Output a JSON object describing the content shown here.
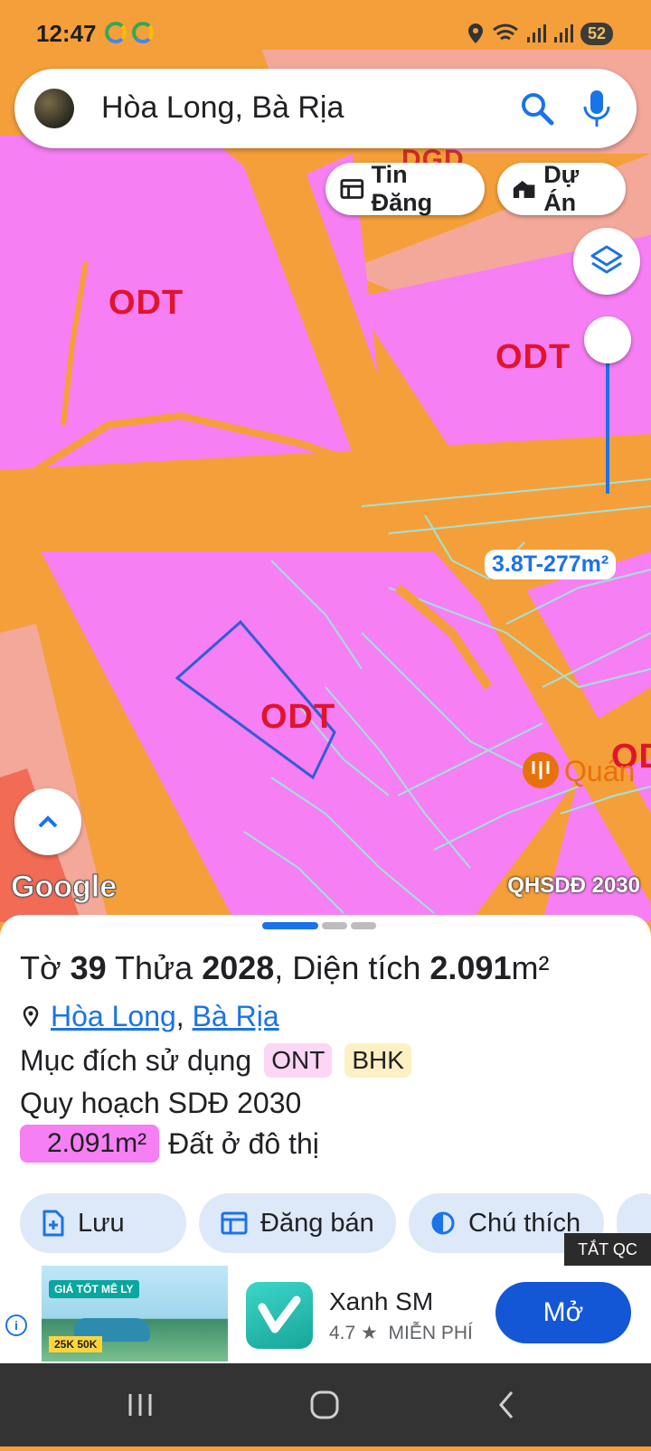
{
  "status_bar": {
    "time": "12:47",
    "battery": "52"
  },
  "search": {
    "query": "Hòa Long, Bà Rịa"
  },
  "chips": {
    "listings": "Tin Đăng",
    "projects": "Dự Án"
  },
  "map": {
    "labels": [
      "ODT",
      "ODT",
      "ODT",
      "OD"
    ],
    "partial_label": "DGD",
    "price_label": "3.8T-277m²",
    "poi_label": "Quán",
    "attribution": "Google",
    "layer_name": "QHSDĐ 2030",
    "colors": {
      "residential": "#F67FF3",
      "road": "#F59F3A",
      "other": "#F4A89A",
      "parcel_outline": "#2F5DD6"
    }
  },
  "parcel": {
    "sheet_word": "Tờ",
    "sheet": "39",
    "plot_word": "Thửa",
    "plot": "2028",
    "area_word": "Diện tích",
    "area": "2.091",
    "area_unit": "m²",
    "ward": "Hòa Long",
    "city": "Bà Rịa",
    "purpose_label": "Mục đích sử dụng",
    "purpose_tags": [
      "ONT",
      "BHK"
    ],
    "plan_label": "Quy hoạch SDĐ 2030",
    "plan_area": "2.091m²",
    "plan_area_desc": "Đất ở đô thị"
  },
  "actions": {
    "save": "Lưu",
    "sell": "Đăng bán",
    "legend": "Chú thích"
  },
  "ad": {
    "close_label": "TẮT QC",
    "banner_promo": "GIÁ TỐT MÊ LY",
    "banner_badge": "25K 50K",
    "app_name": "Xanh SM",
    "rating": "4.7 ★",
    "price": "MIỄN PHÍ",
    "open_label": "Mở"
  }
}
